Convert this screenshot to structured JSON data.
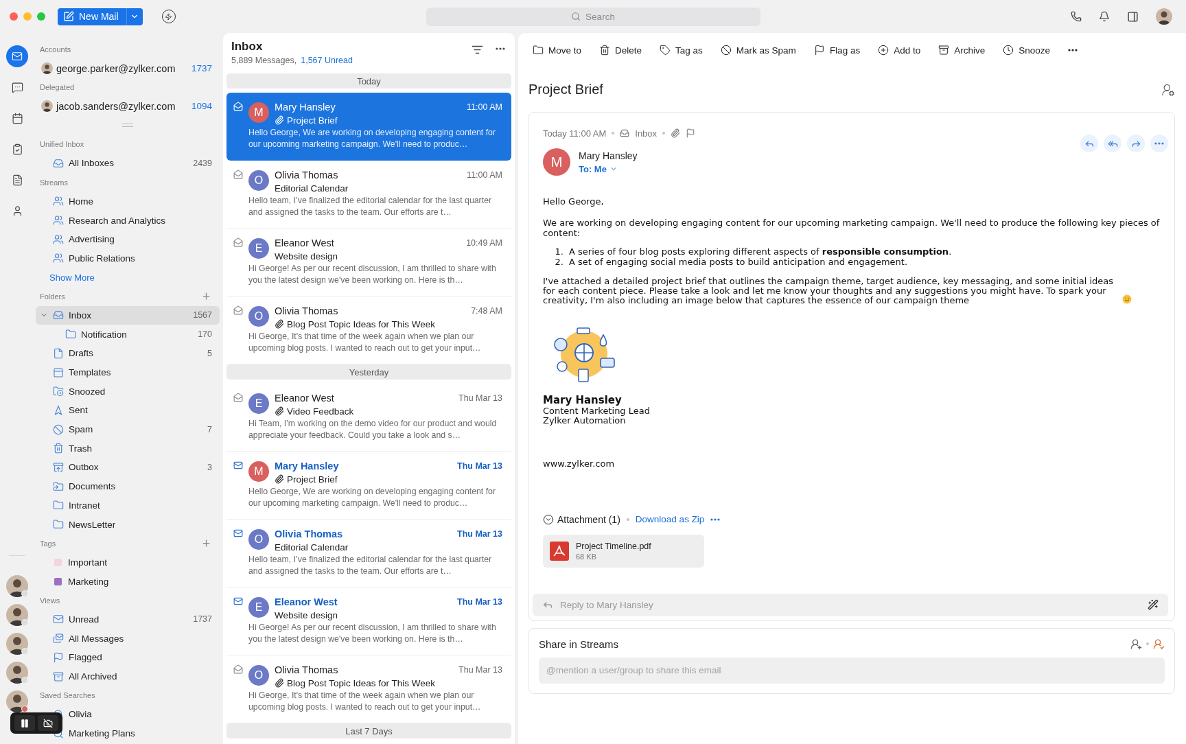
{
  "top_bar": {
    "new_mail": "New Mail",
    "search": {
      "placeholder": "Search"
    }
  },
  "rail": {
    "apps": [
      {
        "kind": "mail",
        "selected": true
      },
      {
        "kind": "chat",
        "selected": false
      },
      {
        "kind": "calendar",
        "selected": false
      },
      {
        "kind": "tasks",
        "selected": false
      },
      {
        "kind": "notes",
        "selected": false
      },
      {
        "kind": "contacts",
        "selected": false
      }
    ],
    "people": [
      {
        "color": "#dcdcdc"
      },
      {
        "color": "#dcdcdc"
      },
      {
        "color": "#dcdcdc"
      },
      {
        "color": "#dcdcdc"
      },
      {
        "color": "#d46a5f"
      }
    ]
  },
  "sidebar": {
    "accounts": [
      {
        "heading": "Accounts",
        "email": "george.parker@zylker.com",
        "count": "1737"
      },
      {
        "heading": "Delegated",
        "email": "jacob.sanders@zylker.com",
        "count": "1094"
      }
    ],
    "sections": [
      {
        "title": "Unified Inbox",
        "items": [
          {
            "kind": "inbox",
            "label": "All Inboxes",
            "count": "2439",
            "selected": false
          }
        ]
      },
      {
        "title": "Streams",
        "more": "Show More",
        "items": [
          {
            "kind": "stream",
            "label": "Home",
            "selected": false
          },
          {
            "kind": "stream",
            "label": "Research and Analytics",
            "selected": false
          },
          {
            "kind": "stream",
            "label": "Advertising",
            "selected": false
          },
          {
            "kind": "stream",
            "label": "Public Relations",
            "selected": false
          }
        ]
      },
      {
        "title": "Folders",
        "add": true,
        "items": [
          {
            "kind": "inbox",
            "label": "Inbox",
            "count": "1567",
            "selected": true,
            "expanded": true,
            "children": [
              {
                "kind": "folder",
                "label": "Notification",
                "count": "170",
                "selected": false
              }
            ]
          },
          {
            "kind": "drafts",
            "label": "Drafts",
            "count": "5",
            "selected": false
          },
          {
            "kind": "templates",
            "label": "Templates",
            "selected": false
          },
          {
            "kind": "snoozed",
            "label": "Snoozed",
            "selected": false
          },
          {
            "kind": "sent",
            "label": "Sent",
            "selected": false
          },
          {
            "kind": "spam",
            "label": "Spam",
            "count": "7",
            "selected": false
          },
          {
            "kind": "trash",
            "label": "Trash",
            "selected": false
          },
          {
            "kind": "outbox",
            "label": "Outbox",
            "count": "3",
            "selected": false
          },
          {
            "kind": "shared",
            "label": "Documents",
            "selected": false
          },
          {
            "kind": "folder",
            "label": "Intranet",
            "selected": false
          },
          {
            "kind": "folder",
            "label": "NewsLetter",
            "selected": false
          }
        ]
      },
      {
        "title": "Tags",
        "add": true,
        "items": [
          {
            "kind": "tag",
            "label": "Important",
            "color": "#f3d5dc",
            "selected": false
          },
          {
            "kind": "tag",
            "label": "Marketing",
            "color": "#9b6fc4",
            "selected": false
          }
        ]
      },
      {
        "title": "Views",
        "items": [
          {
            "kind": "unread",
            "label": "Unread",
            "count": "1737",
            "selected": false
          },
          {
            "kind": "all",
            "label": "All Messages",
            "selected": false
          },
          {
            "kind": "flag",
            "label": "Flagged",
            "selected": false
          },
          {
            "kind": "archive",
            "label": "All Archived",
            "selected": false
          }
        ]
      },
      {
        "title": "Saved Searches",
        "items": [
          {
            "kind": "search",
            "label": "Olivia",
            "selected": false
          },
          {
            "kind": "search",
            "label": "Marketing Plans",
            "selected": false
          }
        ]
      }
    ]
  },
  "message_list": {
    "title": "Inbox",
    "total": "5,889 Messages,",
    "unread": "1,567 Unread",
    "groups": [
      {
        "label": "Today",
        "messages": [
          {
            "sender": "Mary Hansley",
            "initial": "M",
            "color": "#d9605e",
            "time": "11:00 AM",
            "subject": "Project Brief",
            "attachment": true,
            "unread": false,
            "selected": true,
            "preview": "Hello George, We are working on developing engaging content for our upcoming marketing campaign. We'll need to produc…"
          },
          {
            "sender": "Olivia Thomas",
            "initial": "O",
            "color": "#6b79c6",
            "time": "11:00 AM",
            "subject": "Editorial Calendar",
            "attachment": false,
            "unread": false,
            "selected": false,
            "preview": "Hello team, I’ve finalized the editorial calendar for the last quarter and assigned the tasks to the team. Our efforts are t…"
          },
          {
            "sender": "Eleanor West",
            "initial": "E",
            "color": "#6b79c6",
            "time": "10:49 AM",
            "subject": "Website design",
            "attachment": false,
            "unread": false,
            "selected": false,
            "preview": "Hi George! As per our recent discussion, I am thrilled to share with you the latest design we've been working on. Here is th…"
          },
          {
            "sender": "Olivia Thomas",
            "initial": "O",
            "color": "#6b79c6",
            "time": "7:48 AM",
            "subject": "Blog Post Topic Ideas for This Week",
            "attachment": true,
            "unread": false,
            "selected": false,
            "preview": "Hi George, It's that time of the week again when we plan our upcoming blog posts. I wanted to reach out to get your input…"
          }
        ]
      },
      {
        "label": "Yesterday",
        "messages": [
          {
            "sender": "Eleanor West",
            "initial": "E",
            "color": "#6b79c6",
            "time": "Thu Mar 13",
            "subject": "Video Feedback",
            "attachment": true,
            "unread": false,
            "selected": false,
            "preview": "Hi Team, I’m working on the demo video for our product and would appreciate your feedback. Could you take a look and s…"
          },
          {
            "sender": "Mary Hansley",
            "initial": "M",
            "color": "#d9605e",
            "time": "Thu Mar 13",
            "subject": "Project Brief",
            "attachment": true,
            "unread": true,
            "selected": false,
            "preview": "Hello George, We are working on developing engaging content for our upcoming marketing campaign. We'll need to produc…"
          },
          {
            "sender": "Olivia Thomas",
            "initial": "O",
            "color": "#6b79c6",
            "time": "Thu Mar 13",
            "subject": "Editorial Calendar",
            "attachment": false,
            "unread": true,
            "selected": false,
            "preview": "Hello team, I’ve finalized the editorial calendar for the last quarter and assigned the tasks to the team. Our efforts are t…"
          },
          {
            "sender": "Eleanor West",
            "initial": "E",
            "color": "#6b79c6",
            "time": "Thu Mar 13",
            "subject": "Website design",
            "attachment": false,
            "unread": true,
            "selected": false,
            "preview": "Hi George! As per our recent discussion, I am thrilled to share with you the latest design we've been working on. Here is th…"
          },
          {
            "sender": "Olivia Thomas",
            "initial": "O",
            "color": "#6b79c6",
            "time": "Thu Mar 13",
            "subject": "Blog Post Topic Ideas for This Week",
            "attachment": true,
            "unread": false,
            "selected": false,
            "preview": "Hi George, It's that time of the week again when we plan our upcoming blog posts. I wanted to reach out to get your input…"
          }
        ]
      },
      {
        "label": "Last 7 Days"
      }
    ]
  },
  "toolbar": [
    {
      "kind": "folder",
      "label": "Move to"
    },
    {
      "kind": "trash",
      "label": "Delete"
    },
    {
      "kind": "tag",
      "label": "Tag as"
    },
    {
      "kind": "spam",
      "label": "Mark as Spam"
    },
    {
      "kind": "flag",
      "label": "Flag as"
    },
    {
      "kind": "add",
      "label": "Add to"
    },
    {
      "kind": "archive",
      "label": "Archive"
    },
    {
      "kind": "clock",
      "label": "Snooze"
    }
  ],
  "email": {
    "subject": "Project Brief",
    "date": "Today 11:00 AM",
    "folder": "Inbox",
    "has_attachment": true,
    "flagged": false,
    "sender": {
      "name": "Mary Hansley",
      "initial": "M",
      "color": "#d9605e"
    },
    "recipient": "To: Me",
    "greeting": "Hello George,",
    "intro": "We are working on developing engaging content for our upcoming marketing campaign. We'll need to produce the following key pieces of content:",
    "list": [
      {
        "marker": "1.",
        "text": "A series of four blog posts exploring different aspects of **responsible consumption**."
      },
      {
        "marker": "2.",
        "text": "A set of engaging social media posts to build anticipation and engagement."
      }
    ],
    "closing": "I've attached a detailed project brief that outlines the campaign theme, target audience, key messaging, and some initial ideas for each content piece. Please take a look and let me know your thoughts and any suggestions you might have. To spark your creativity, I'm also including an image below that captures the essence of our campaign theme",
    "signature": {
      "name": "Mary Hansley",
      "title": "Content Marketing Lead",
      "company": "Zylker Automation"
    },
    "website": "www.zylker.com",
    "attachments": {
      "label": "Attachment (1)",
      "download": "Download as Zip",
      "expanded": true,
      "files": [
        {
          "name": "Project Timeline.pdf",
          "size": "68 KB"
        }
      ]
    },
    "reply": {
      "placeholder": "Reply to Mary Hansley"
    }
  },
  "share": {
    "title": "Share in Streams",
    "placeholder": "@mention a user/group to share this email"
  }
}
